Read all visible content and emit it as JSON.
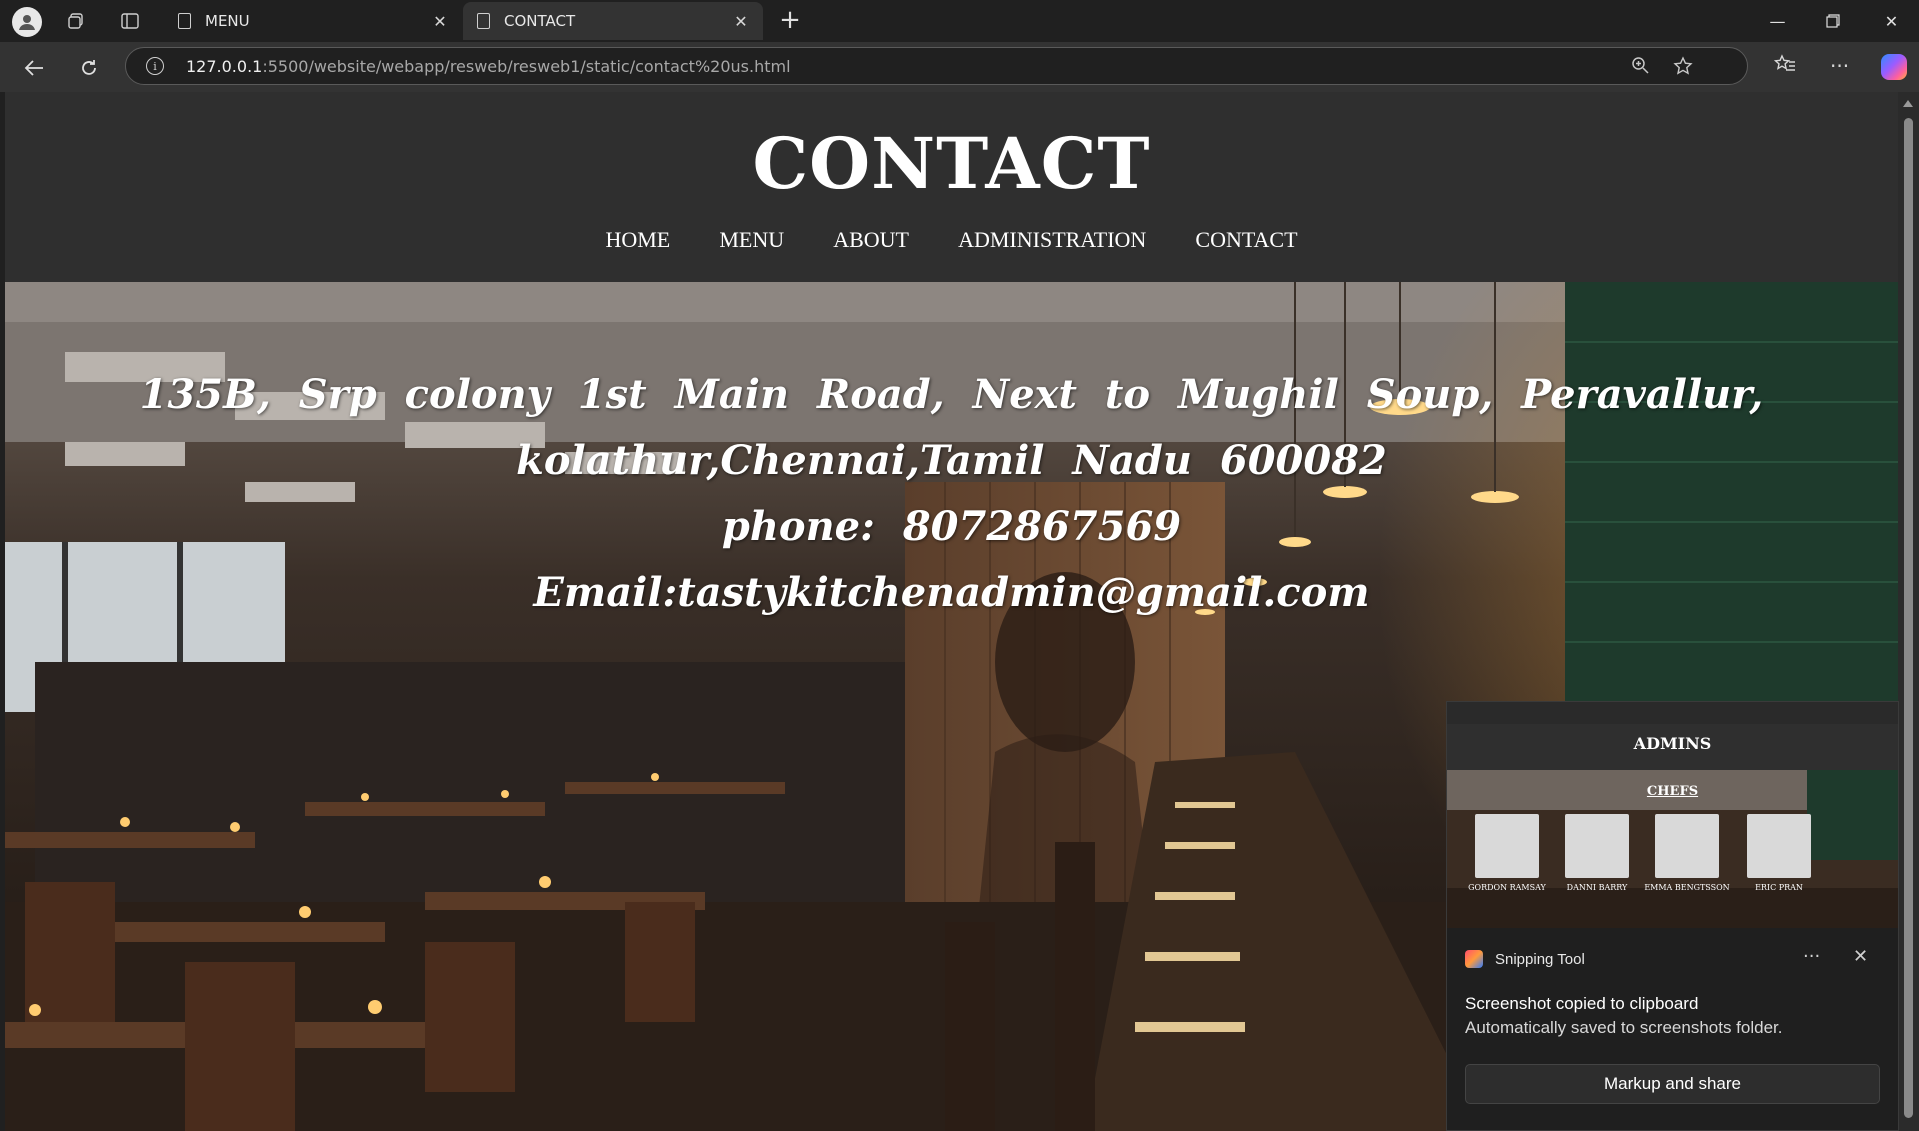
{
  "browser": {
    "tabs": [
      {
        "label": "MENU",
        "active": false
      },
      {
        "label": "CONTACT",
        "active": true
      }
    ],
    "url_host": "127.0.0.1",
    "url_rest": ":5500/website/webapp/resweb/resweb1/static/contact%20us.html"
  },
  "site": {
    "title": "CONTACT",
    "nav": [
      "HOME",
      "MENU",
      "ABOUT",
      "ADMINISTRATION",
      "CONTACT"
    ],
    "contact_lines": [
      "135B, Srp colony 1st Main Road, Next to Mughil Soup, Peravallur,",
      "kolathur,Chennai,Tamil Nadu 600082",
      "phone: 8072867569",
      "Email:tastykitchenadmin@gmail.com"
    ]
  },
  "toast": {
    "app_name": "Snipping Tool",
    "message": "Screenshot copied to clipboard",
    "submessage": "Automatically saved to screenshots folder.",
    "action_label": "Markup and share",
    "preview": {
      "title": "ADMINS",
      "section": "CHEFS",
      "chefs": [
        "GORDON RAMSAY",
        "DANNI BARRY",
        "EMMA BENGTSSON",
        "ERIC PRAN"
      ]
    }
  }
}
